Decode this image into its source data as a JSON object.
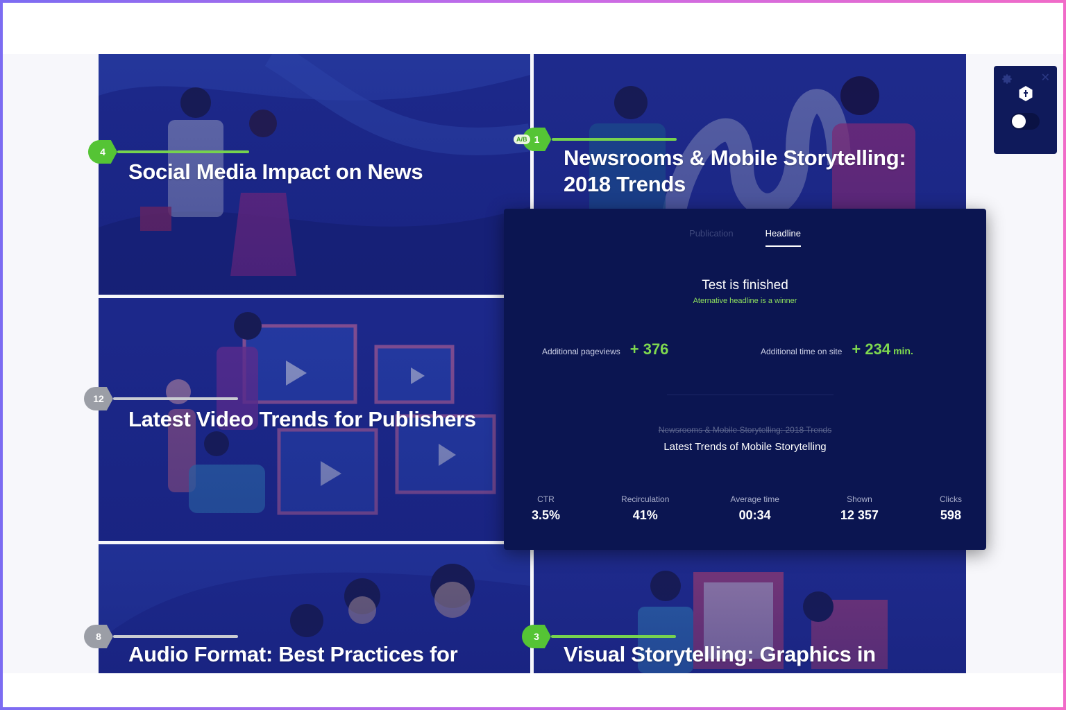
{
  "cards": [
    {
      "title": "Social Media Impact on News",
      "rank": "4",
      "rank_style": "green"
    },
    {
      "title": "Newsrooms & Mobile Storytelling: 2018 Trends",
      "rank": "1",
      "ab_label": "A/B",
      "rank_style": "green"
    },
    {
      "title": "Latest Video Trends for Publishers",
      "rank": "12",
      "rank_style": "gray"
    },
    {
      "title": "Audio Format: Best Practices for",
      "rank": "8",
      "rank_style": "gray"
    },
    {
      "title": "Visual Storytelling: Graphics in",
      "rank": "3",
      "rank_style": "green"
    }
  ],
  "popup": {
    "tabs": [
      {
        "label": "Publication",
        "active": false
      },
      {
        "label": "Headline",
        "active": true
      }
    ],
    "status_title": "Test is finished",
    "status_subtitle": "Aternative headline is a winner",
    "pageviews_label": "Additional pageviews",
    "pageviews_value": "+ 376",
    "time_label": "Additional time on site",
    "time_value": "+ 234",
    "time_unit": "min.",
    "old_headline": "Newsrooms & Mobile Storytelling: 2018 Trends",
    "new_headline": "Latest Trends of Mobile Storytelling",
    "stats": [
      {
        "label": "CTR",
        "value": "3.5%"
      },
      {
        "label": "Recirculation",
        "value": "41%"
      },
      {
        "label": "Average time",
        "value": "00:34"
      },
      {
        "label": "Shown",
        "value": "12 357"
      },
      {
        "label": "Clicks",
        "value": "598"
      }
    ]
  },
  "widget": {
    "icons": [
      "gear-icon",
      "close-icon",
      "hexagon-logo-icon"
    ],
    "toggle_on": false
  },
  "colors": {
    "card_bg": "#1f2b86",
    "popup_bg": "#0b1551",
    "accent_green": "#7fd94f",
    "badge_gray": "#9b9ea6"
  }
}
